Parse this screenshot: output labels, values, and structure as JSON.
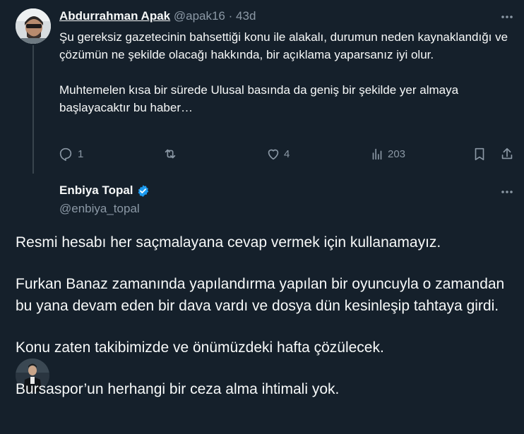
{
  "reply": {
    "author_name": "Abdurrahman Apak",
    "handle": "@apak16",
    "separator": "·",
    "age": "43d",
    "more_icon": "more-horizontal-icon",
    "paragraphs": [
      "Şu gereksiz gazetecinin bahsettiği konu ile alakalı, durumun neden kaynaklandığı ve çözümün ne şekilde olacağı hakkında, bir açıklama yaparsanız iyi olur.",
      "Muhtemelen kısa bir sürede Ulusal basında da geniş bir şekilde yer almaya başlayacaktır bu haber…"
    ],
    "reply_count": "1",
    "retweet_count": "",
    "like_count": "4",
    "view_count": "203"
  },
  "main": {
    "author_name": "Enbiya Topal",
    "handle": "@enbiya_topal",
    "verified_color": "#1d9bf0",
    "paragraphs": [
      "Resmi hesabı her saçmalayana cevap vermek için kullanamayız.",
      "Furkan Banaz zamanında yapılandırma yapılan bir oyuncuyla o zamandan bu yana devam eden bir dava vardı ve dosya dün kesinleşip tahtaya girdi.",
      "Konu zaten takibimizde ve önümüzdeki hafta çözülecek.",
      "Bursaspor’un herhangi bir ceza alma ihtimali yok."
    ]
  },
  "colors": {
    "background": "#15202b",
    "text": "#f7f9f9",
    "muted": "#8b98a5",
    "divider": "#38444d"
  }
}
